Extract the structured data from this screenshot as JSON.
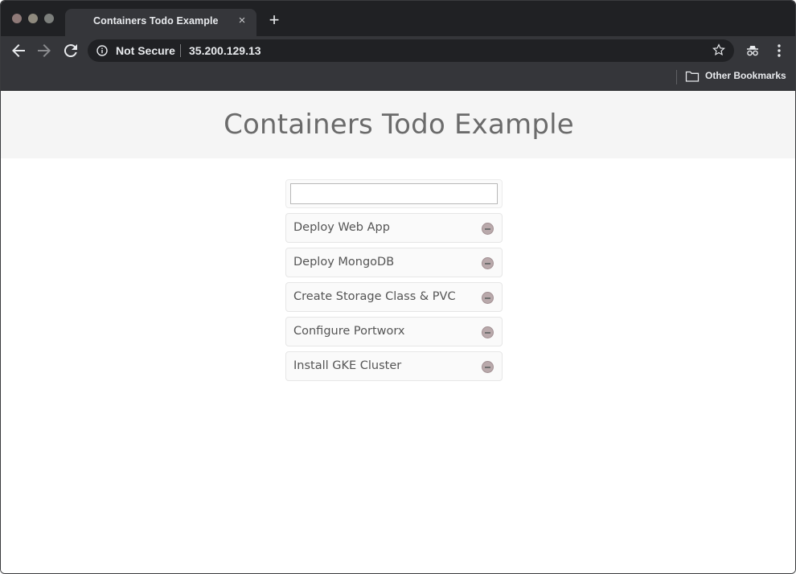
{
  "browser": {
    "tab_title": "Containers Todo Example",
    "tab_close": "×",
    "new_tab": "+",
    "security_label": "Not Secure",
    "url": "35.200.129.13",
    "bookmarks": {
      "other_label": "Other Bookmarks"
    }
  },
  "page": {
    "title": "Containers Todo Example",
    "new_todo_value": "",
    "todos": [
      {
        "label": "Deploy Web App"
      },
      {
        "label": "Deploy MongoDB"
      },
      {
        "label": "Create Storage Class & PVC"
      },
      {
        "label": "Configure Portworx"
      },
      {
        "label": "Install GKE Cluster"
      }
    ]
  },
  "icons": {
    "back": "back-arrow-icon",
    "forward": "forward-arrow-icon",
    "reload": "reload-icon",
    "info": "info-icon",
    "star": "star-icon",
    "extension": "incognito-icon",
    "menu": "kebab-menu-icon",
    "folder": "folder-icon",
    "remove": "remove-circle-icon"
  },
  "colors": {
    "chrome_dark": "#202124",
    "chrome_toolbar": "#35363a",
    "hero_bg": "#f5f5f5",
    "title_text": "#6b6b6b"
  }
}
